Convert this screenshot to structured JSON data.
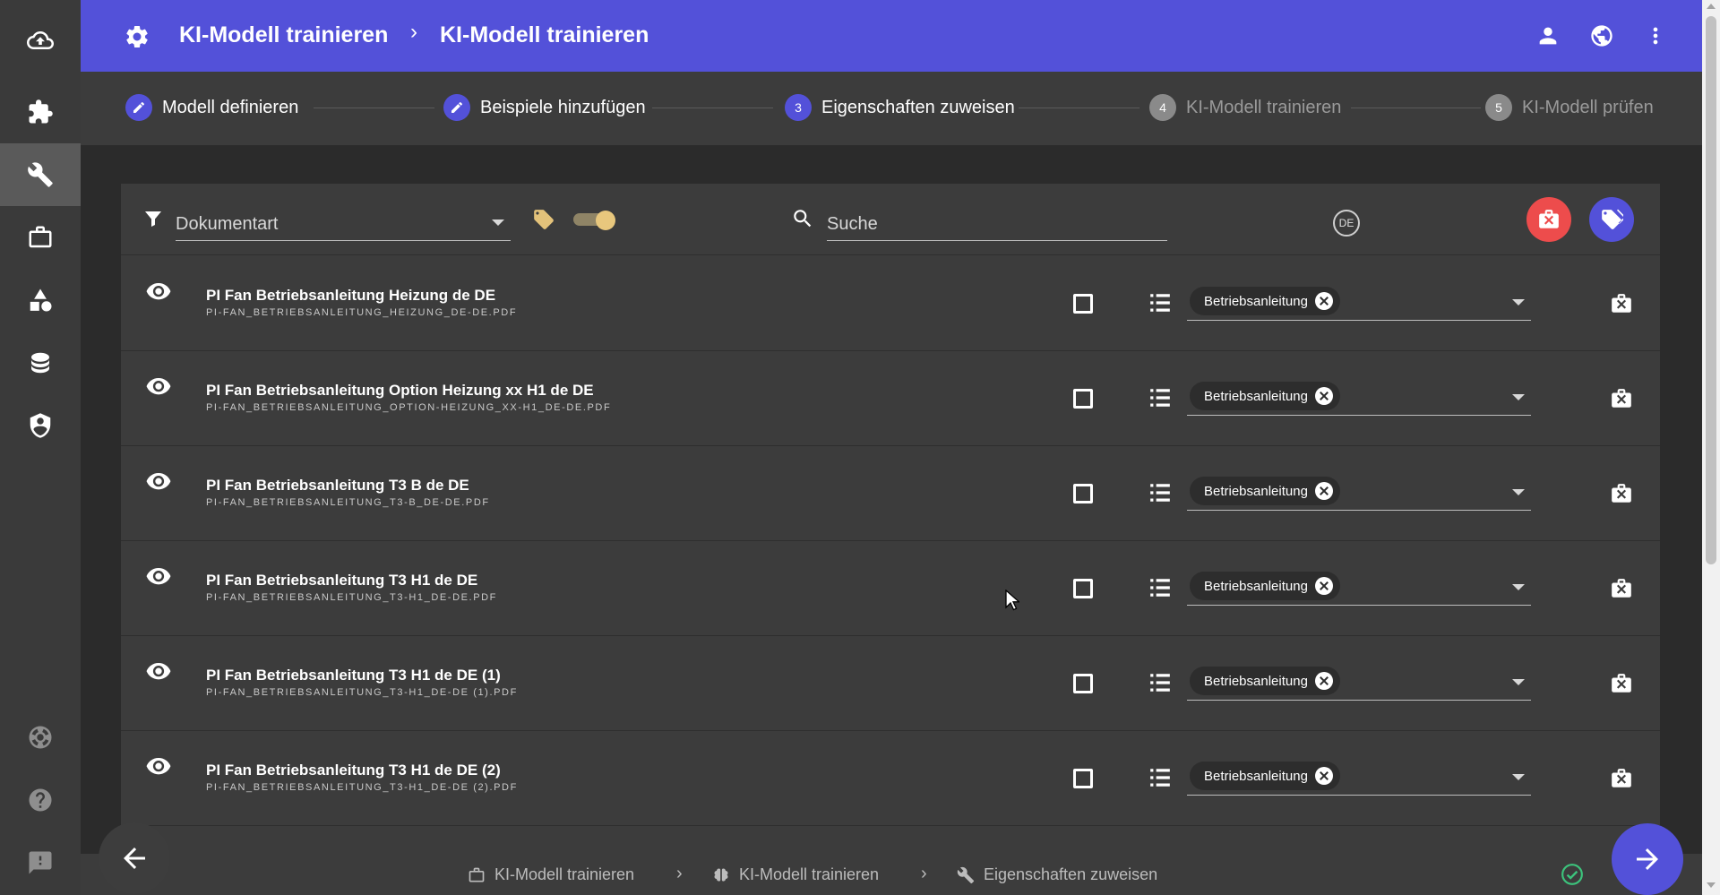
{
  "header": {
    "title": "KI-Modell trainieren",
    "subtitle": "KI-Modell trainieren",
    "separator": "›"
  },
  "sidebar": {
    "items": [
      {
        "icon": "cloud-upload-icon"
      },
      {
        "icon": "puzzle-icon"
      },
      {
        "icon": "wrench-icon",
        "active": true
      },
      {
        "icon": "briefcase-icon"
      },
      {
        "icon": "shapes-icon"
      },
      {
        "icon": "database-icon"
      },
      {
        "icon": "shield-account-icon"
      },
      {
        "icon": "lifebuoy-icon"
      },
      {
        "icon": "help-icon"
      },
      {
        "icon": "feedback-icon"
      }
    ]
  },
  "stepper": {
    "steps": [
      {
        "number": "",
        "label": "Modell definieren",
        "state": "done"
      },
      {
        "number": "",
        "label": "Beispiele hinzufügen",
        "state": "done"
      },
      {
        "number": "3",
        "label": "Eigenschaften zuweisen",
        "state": "current"
      },
      {
        "number": "4",
        "label": "KI-Modell trainieren",
        "state": "todo"
      },
      {
        "number": "5",
        "label": "KI-Modell prüfen",
        "state": "todo"
      }
    ]
  },
  "toolbar": {
    "filter_value": "Dokumentart",
    "search_placeholder": "Suche",
    "language_badge": "DE",
    "tag_toggle_on": true
  },
  "documents": [
    {
      "title": "PI Fan Betriebsanleitung Heizung de DE",
      "file": "PI-FAN_BETRIEBSANLEITUNG_HEIZUNG_DE-DE.PDF",
      "tag": "Betriebsanleitung",
      "checked": false
    },
    {
      "title": "PI Fan Betriebsanleitung Option Heizung xx H1 de DE",
      "file": "PI-FAN_BETRIEBSANLEITUNG_OPTION-HEIZUNG_XX-H1_DE-DE.PDF",
      "tag": "Betriebsanleitung",
      "checked": false
    },
    {
      "title": "PI Fan Betriebsanleitung T3 B de DE",
      "file": "PI-FAN_BETRIEBSANLEITUNG_T3-B_DE-DE.PDF",
      "tag": "Betriebsanleitung",
      "checked": false
    },
    {
      "title": "PI Fan Betriebsanleitung T3 H1 de DE",
      "file": "PI-FAN_BETRIEBSANLEITUNG_T3-H1_DE-DE.PDF",
      "tag": "Betriebsanleitung",
      "checked": false
    },
    {
      "title": "PI Fan Betriebsanleitung T3 H1 de DE (1)",
      "file": "PI-FAN_BETRIEBSANLEITUNG_T3-H1_DE-DE (1).PDF",
      "tag": "Betriebsanleitung",
      "checked": false
    },
    {
      "title": "PI Fan Betriebsanleitung T3 H1 de DE (2)",
      "file": "PI-FAN_BETRIEBSANLEITUNG_T3-H1_DE-DE (2).PDF",
      "tag": "Betriebsanleitung",
      "checked": false
    }
  ],
  "footer": {
    "crumbs": [
      {
        "label": "KI-Modell trainieren",
        "icon": "briefcase-outline-icon"
      },
      {
        "label": "KI-Modell trainieren",
        "icon": "brain-icon"
      },
      {
        "label": "Eigenschaften zuweisen",
        "icon": "wrench-icon"
      }
    ],
    "separator": "›"
  },
  "colors": {
    "accent": "#5351d9",
    "danger": "#ed4c4c",
    "tag": "#e3c27a",
    "success": "#3cc47c"
  }
}
